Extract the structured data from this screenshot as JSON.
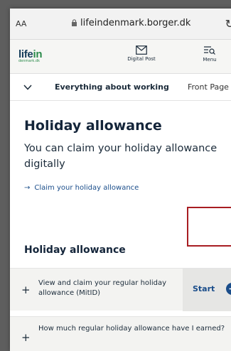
{
  "browser": {
    "text_size_label": "AA",
    "url": "lifeindenmark.borger.dk"
  },
  "header": {
    "logo_main": "life",
    "logo_in": "in",
    "logo_sub": "denmark.dk",
    "digital_post_label": "Digital Post",
    "menu_label": "Menu"
  },
  "breadcrumb": {
    "current": "Everything about working",
    "next": "Front Page"
  },
  "main": {
    "title": "Holiday allowance",
    "intro": "You can claim your holiday allowance digitally",
    "claim_link": "Claim your holiday allowance",
    "section_title": "Holiday allowance"
  },
  "accordion": [
    {
      "label": "View and claim your regular holiday allowance (MitID)",
      "action": "Start"
    },
    {
      "label": "How much regular holiday allowance have I earned?"
    }
  ],
  "colors": {
    "accent": "#1a4d8a",
    "highlight_box": "#a81d22",
    "logo_green": "#2a8a4a"
  }
}
